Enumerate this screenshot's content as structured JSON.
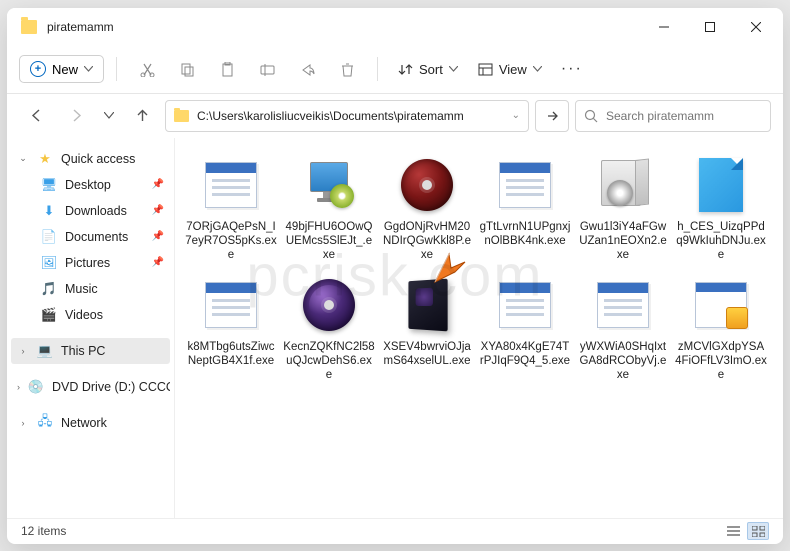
{
  "window": {
    "title": "piratemamm"
  },
  "toolbar": {
    "new_label": "New",
    "sort_label": "Sort",
    "view_label": "View"
  },
  "address": {
    "path": "C:\\Users\\karolisliucveikis\\Documents\\piratemamm"
  },
  "search": {
    "placeholder": "Search piratemamm"
  },
  "sidebar": {
    "quick_access": "Quick access",
    "desktop": "Desktop",
    "downloads": "Downloads",
    "documents": "Documents",
    "pictures": "Pictures",
    "music": "Music",
    "videos": "Videos",
    "this_pc": "This PC",
    "dvd": "DVD Drive (D:) CCCO",
    "network": "Network"
  },
  "files": [
    {
      "name": "7ORjGAQePsN_I7eyR7OS5pKs.exe",
      "icon": "winwin"
    },
    {
      "name": "49bjFHU6OOwQUEMcs5SlEJt_.exe",
      "icon": "installer"
    },
    {
      "name": "GgdONjRvHM20NDIrQGwKkl8P.exe",
      "icon": "reddisc"
    },
    {
      "name": "gTtLvrnN1UPgnxjnOlBBK4nk.exe",
      "icon": "winwin"
    },
    {
      "name": "Gwu1l3iY4aFGwUZan1nEOXn2.exe",
      "icon": "boxpkg"
    },
    {
      "name": "h_CES_UizqPPdq9WkIuhDNJu.exe",
      "icon": "bluepage"
    },
    {
      "name": "k8MTbg6utsZiwcNeptGB4X1f.exe",
      "icon": "winwin"
    },
    {
      "name": "KecnZQKfNC2l58uQJcwDehS6.exe",
      "icon": "purpdisc"
    },
    {
      "name": "XSEV4bwrviOJjamS64xselUL.exe",
      "icon": "darkbox"
    },
    {
      "name": "XYA80x4KgE74TrPJIqF9Q4_5.exe",
      "icon": "winwin"
    },
    {
      "name": "yWXWiA0SHqIxtGA8dRCObyVj.exe",
      "icon": "winwin"
    },
    {
      "name": "zMCVlGXdpYSA4FiOFfLV3ImO.exe",
      "icon": "winapp"
    }
  ],
  "status": {
    "count": "12 items"
  },
  "watermark": "pcrisk.com"
}
